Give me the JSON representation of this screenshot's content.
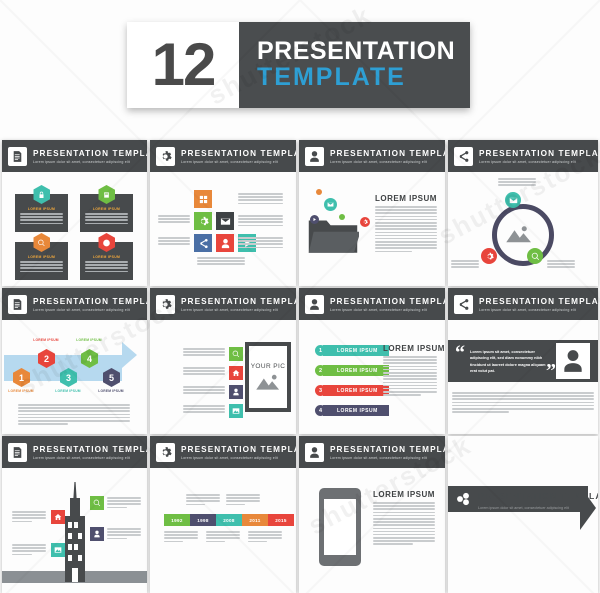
{
  "banner": {
    "number": "12",
    "line1": "PRESENTATION",
    "line2": "TEMPLATE"
  },
  "common": {
    "slide_title": "PRESENTATION  TEMPLATE",
    "slide_subtitle": "Lorem ipsum dolor sit amet, consectetuer adipiscing elit",
    "lorem_heading": "LOREM IPSUM",
    "item_label": "LOREM IPSUM",
    "your_pic": "YOUR PIC",
    "quote_text": "Lorem ipsum sit amet, consectetuer adipiscing elit, sed diam nonummy nibh tincidunt ut laoreet dolore magna aliquam erat volut pat."
  },
  "colors": {
    "dark": "#474a4c",
    "accent_blue": "#2e9fd4",
    "teal": "#3fbfad",
    "green": "#6fbe44",
    "orange": "#e8883a",
    "red": "#e8453c",
    "purple": "#4f4f6e",
    "blue": "#4a6fa5",
    "arrow_blue": "#b6d9ef"
  },
  "slides": [
    {
      "index": 1,
      "header_icon": "document-icon",
      "title": "PRESENTATION  TEMPLATE",
      "subtitle": "Lorem ipsum dolor sit amet, consectetuer adipiscing elit",
      "layout": "four-hex-cards",
      "cards": [
        {
          "label": "LOREM IPSUM",
          "color": "#3fbfad",
          "icon": "lock-icon"
        },
        {
          "label": "LOREM IPSUM",
          "color": "#6fbe44",
          "icon": "book-icon"
        },
        {
          "label": "LOREM IPSUM",
          "color": "#e8883a",
          "icon": "search-icon"
        },
        {
          "label": "LOREM IPSUM",
          "color": "#e8453c",
          "icon": "clock-icon"
        }
      ]
    },
    {
      "index": 2,
      "header_icon": "gear-icon",
      "title": "PRESENTATION  TEMPLATE",
      "subtitle": "Lorem ipsum dolor sit amet, consectetuer adipiscing elit",
      "layout": "icon-tile-grid",
      "tiles": [
        {
          "icon": "grid-icon",
          "color": "#e8883a"
        },
        {
          "icon": "gear-icon",
          "color": "#6fbe44"
        },
        {
          "icon": "mail-icon",
          "color": "#3e4245"
        },
        {
          "icon": "share-icon",
          "color": "#4a6fa5"
        },
        {
          "icon": "person-icon",
          "color": "#e8453c"
        },
        {
          "icon": "play-icon",
          "color": "#3fbfad"
        }
      ]
    },
    {
      "index": 3,
      "header_icon": "person-icon",
      "title": "PRESENTATION  TEMPLATE",
      "subtitle": "Lorem ipsum dolor sit amet, consectetuer adipiscing elit",
      "layout": "folder-graphic",
      "heading": "LOREM IPSUM",
      "bubbles": [
        {
          "icon": "mail-icon",
          "color": "#3fbfad"
        },
        {
          "icon": "play-icon",
          "color": "#4f4f6e"
        },
        {
          "icon": "dot-icon",
          "color": "#e8883a"
        },
        {
          "icon": "dot-icon",
          "color": "#6fbe44"
        },
        {
          "icon": "gear-icon",
          "color": "#e8453c"
        }
      ]
    },
    {
      "index": 4,
      "header_icon": "share-icon",
      "title": "PRESENTATION  TEMPLATE",
      "subtitle": "Lorem ipsum dolor sit amet, consectetuer adipiscing elit",
      "layout": "circle-diagram",
      "nodes": [
        {
          "icon": "mail-icon",
          "color": "#3fbfad"
        },
        {
          "icon": "gear-icon",
          "color": "#e8453c"
        },
        {
          "icon": "search-icon",
          "color": "#6fbe44"
        }
      ]
    },
    {
      "index": 5,
      "header_icon": "document-icon",
      "title": "PRESENTATION  TEMPLATE",
      "subtitle": "Lorem ipsum dolor sit amet, consectetuer adipiscing elit",
      "layout": "arrow-timeline",
      "steps": [
        {
          "num": "1",
          "label": "LOREM IPSUM",
          "color": "#e8883a"
        },
        {
          "num": "2",
          "label": "LOREM IPSUM",
          "color": "#e8453c"
        },
        {
          "num": "3",
          "label": "LOREM IPSUM",
          "color": "#3fbfad"
        },
        {
          "num": "4",
          "label": "LOREM IPSUM",
          "color": "#6fbe44"
        },
        {
          "num": "5",
          "label": "LOREM IPSUM",
          "color": "#4f4f6e"
        }
      ]
    },
    {
      "index": 6,
      "header_icon": "gear-icon",
      "title": "PRESENTATION  TEMPLATE",
      "subtitle": "Lorem ipsum dolor sit amet, consectetuer adipiscing elit",
      "layout": "list-with-picture",
      "picture_label": "YOUR PIC",
      "rows": [
        {
          "icon": "search-icon",
          "color": "#6fbe44"
        },
        {
          "icon": "home-icon",
          "color": "#e8453c"
        },
        {
          "icon": "person-icon",
          "color": "#4f4f6e"
        },
        {
          "icon": "image-icon",
          "color": "#3fbfad"
        }
      ]
    },
    {
      "index": 7,
      "header_icon": "person-icon",
      "title": "PRESENTATION  TEMPLATE",
      "subtitle": "Lorem ipsum dolor sit amet, consectetuer adipiscing elit",
      "layout": "numbered-ribbons",
      "heading": "LOREM IPSUM",
      "ribbons": [
        {
          "num": "1",
          "label": "LOREM IPSUM",
          "color": "#3fbfad"
        },
        {
          "num": "2",
          "label": "LOREM IPSUM",
          "color": "#6fbe44"
        },
        {
          "num": "3",
          "label": "LOREM IPSUM",
          "color": "#e8453c"
        },
        {
          "num": "4",
          "label": "LOREM IPSUM",
          "color": "#4f4f6e"
        }
      ]
    },
    {
      "index": 8,
      "header_icon": "share-icon",
      "title": "PRESENTATION  TEMPLATE",
      "subtitle": "Lorem ipsum dolor sit amet, consectetuer adipiscing elit",
      "layout": "testimonial-quote",
      "quote": "Lorem ipsum sit amet, consectetuer adipiscing elit, sed diam nonummy nibh tincidunt ut laoreet dolore magna aliquam erat volut pat.",
      "avatar_icon": "person-icon"
    },
    {
      "index": 9,
      "header_icon": "document-icon",
      "title": "PRESENTATION  TEMPLATE",
      "subtitle": "Lorem ipsum dolor sit amet, consectetuer adipiscing elit",
      "layout": "city-building",
      "markers": [
        {
          "icon": "home-icon",
          "color": "#e8453c"
        },
        {
          "icon": "search-icon",
          "color": "#6fbe44"
        },
        {
          "icon": "person-icon",
          "color": "#4f4f6e"
        },
        {
          "icon": "image-icon",
          "color": "#3fbfad"
        }
      ]
    },
    {
      "index": 10,
      "header_icon": "gear-icon",
      "title": "PRESENTATION  TEMPLATE",
      "subtitle": "Lorem ipsum dolor sit amet, consectetuer adipiscing elit",
      "layout": "year-timeline",
      "years": [
        {
          "year": "1992",
          "color": "#6fbe44"
        },
        {
          "year": "1998",
          "color": "#4f4f6e"
        },
        {
          "year": "2008",
          "color": "#3fbfad"
        },
        {
          "year": "2011",
          "color": "#e8883a"
        },
        {
          "year": "2015",
          "color": "#e8453c"
        }
      ]
    },
    {
      "index": 11,
      "header_icon": "person-icon",
      "title": "PRESENTATION  TEMPLATE",
      "subtitle": "Lorem ipsum dolor sit amet, consectetuer adipiscing elit",
      "layout": "smartphone-mockup",
      "heading": "LOREM IPSUM"
    },
    {
      "index": 12,
      "header_icon": "hex-cluster-icon",
      "title": "PRESENTATION  TEMPLATE",
      "subtitle": "Lorem ipsum dolor sit amet, consectetuer adipiscing elit",
      "layout": "title-chevron"
    }
  ]
}
